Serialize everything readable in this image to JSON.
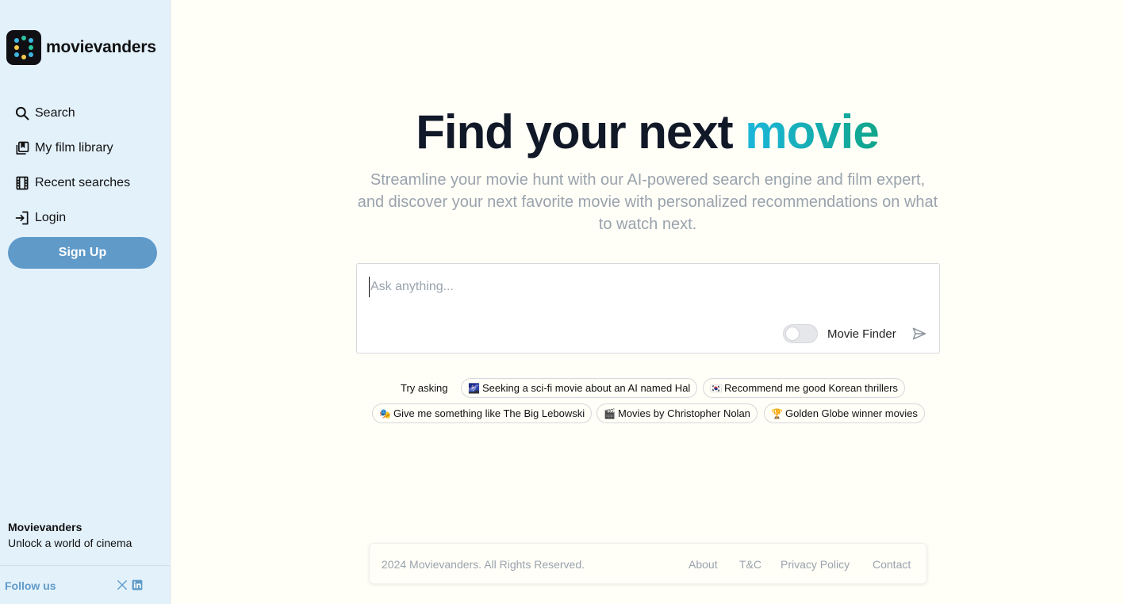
{
  "brand": {
    "name": "movievanders",
    "colors": {
      "logo_bg": "#0f0f14",
      "dot_yellow": "#f2c94c",
      "dot_blue": "#3fb6e0",
      "dot_green": "#2ec4a0"
    }
  },
  "sidebar": {
    "nav": [
      {
        "label": "Search",
        "icon": "search-icon"
      },
      {
        "label": "My film library",
        "icon": "library-icon"
      },
      {
        "label": "Recent searches",
        "icon": "film-strip-icon"
      },
      {
        "label": "Login",
        "icon": "login-icon"
      }
    ],
    "signup_label": "Sign Up",
    "footer_brand": "Movievanders",
    "footer_tagline": "Unlock a world of cinema",
    "follow_label": "Follow us",
    "social": [
      "x-icon",
      "linkedin-icon"
    ]
  },
  "hero": {
    "title_main": "Find your next ",
    "title_accent": "movie",
    "subtitle": "Streamline your movie hunt with our AI-powered search engine and film expert, and discover your next favorite movie with personalized recommendations on what to watch next."
  },
  "search": {
    "placeholder": "Ask anything...",
    "value": "",
    "toggle_label": "Movie Finder",
    "toggle_on": false
  },
  "suggestions": {
    "label": "Try asking",
    "chips": [
      {
        "emoji": "🌌",
        "text": "Seeking a sci-fi movie about an AI named Hal"
      },
      {
        "emoji": "🇰🇷",
        "text": "Recommend me good Korean thrillers"
      },
      {
        "emoji": "🎭",
        "text": "Give me something like The Big Lebowski"
      },
      {
        "emoji": "🎬",
        "text": "Movies by Christopher Nolan"
      },
      {
        "emoji": "🏆",
        "text": "Golden Globe winner movies"
      }
    ]
  },
  "footer": {
    "copyright": "2024 Movievanders. All Rights Reserved.",
    "links": [
      "About",
      "T&C",
      "Privacy Policy",
      "Contact"
    ]
  },
  "colors": {
    "page_bg": "#fffef7",
    "sidebar_bg": "#e3f1fb",
    "primary": "#5f9ac9",
    "accent_gradient_start": "#1cb6dc",
    "accent_gradient_end": "#11a58a",
    "muted_text": "#9aa3ad"
  }
}
